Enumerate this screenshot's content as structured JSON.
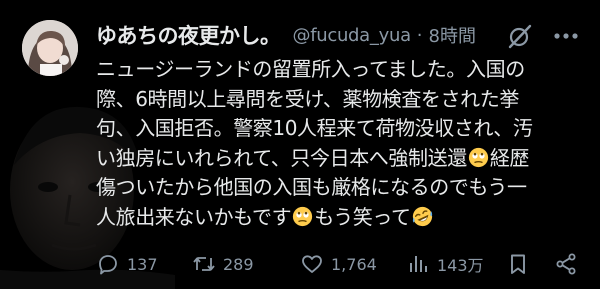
{
  "post": {
    "display_name": "ゆあちの夜更かし。",
    "handle": "@fucuda_yua",
    "separator": "·",
    "time": "8時間",
    "text_lines": [
      "ニュージーランドの留置所入ってました。入国の",
      "際、6時間以上尋問を受け、薬物検査をされた挙",
      "句、入国拒否。警察10人程来て荷物没収され、汚",
      "い独房にいれられて、只今日本へ強制送還",
      "経歴",
      "傷ついたから他国の入国も厳格になるのでもう一",
      "人旅出来ないかもです",
      "もう笑って"
    ]
  },
  "actions": {
    "replies": "137",
    "reposts": "289",
    "likes": "1,764",
    "views": "143万"
  },
  "icons": {
    "grok": "grok-slash-icon",
    "more": "more-icon",
    "reply": "reply-icon",
    "repost": "repost-icon",
    "like": "heart-icon",
    "views": "views-icon",
    "bookmark": "bookmark-icon",
    "share": "share-icon",
    "emoji_face": "rolling-eyes-emoji",
    "emoji_laugh": "rofl-emoji"
  },
  "colors": {
    "background": "#000000",
    "text": "#e7e9ea",
    "secondary": "#8b98a5"
  }
}
